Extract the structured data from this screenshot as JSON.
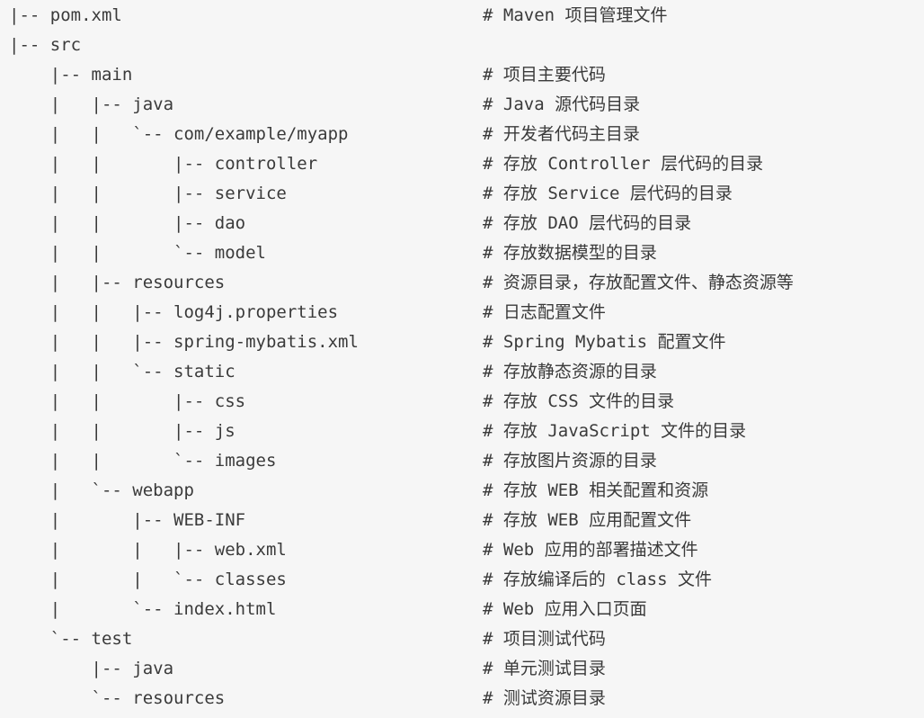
{
  "lines": [
    {
      "tree": "|-- pom.xml",
      "comment": "# Maven 项目管理文件"
    },
    {
      "tree": "|-- src",
      "comment": ""
    },
    {
      "tree": "    |-- main",
      "comment": "# 项目主要代码"
    },
    {
      "tree": "    |   |-- java",
      "comment": "# Java 源代码目录"
    },
    {
      "tree": "    |   |   `-- com/example/myapp",
      "comment": "# 开发者代码主目录"
    },
    {
      "tree": "    |   |       |-- controller",
      "comment": "# 存放 Controller 层代码的目录"
    },
    {
      "tree": "    |   |       |-- service",
      "comment": "# 存放 Service 层代码的目录"
    },
    {
      "tree": "    |   |       |-- dao",
      "comment": "# 存放 DAO 层代码的目录"
    },
    {
      "tree": "    |   |       `-- model",
      "comment": "# 存放数据模型的目录"
    },
    {
      "tree": "    |   |-- resources",
      "comment": "# 资源目录，存放配置文件、静态资源等"
    },
    {
      "tree": "    |   |   |-- log4j.properties",
      "comment": "# 日志配置文件"
    },
    {
      "tree": "    |   |   |-- spring-mybatis.xml",
      "comment": "# Spring Mybatis 配置文件"
    },
    {
      "tree": "    |   |   `-- static",
      "comment": "# 存放静态资源的目录"
    },
    {
      "tree": "    |   |       |-- css",
      "comment": "# 存放 CSS 文件的目录"
    },
    {
      "tree": "    |   |       |-- js",
      "comment": "# 存放 JavaScript 文件的目录"
    },
    {
      "tree": "    |   |       `-- images",
      "comment": "# 存放图片资源的目录"
    },
    {
      "tree": "    |   `-- webapp",
      "comment": "# 存放 WEB 相关配置和资源"
    },
    {
      "tree": "    |       |-- WEB-INF",
      "comment": "# 存放 WEB 应用配置文件"
    },
    {
      "tree": "    |       |   |-- web.xml",
      "comment": "# Web 应用的部署描述文件"
    },
    {
      "tree": "    |       |   `-- classes",
      "comment": "# 存放编译后的 class 文件"
    },
    {
      "tree": "    |       `-- index.html",
      "comment": "# Web 应用入口页面"
    },
    {
      "tree": "    `-- test",
      "comment": "# 项目测试代码"
    },
    {
      "tree": "        |-- java",
      "comment": "# 单元测试目录"
    },
    {
      "tree": "        `-- resources",
      "comment": "# 测试资源目录"
    }
  ]
}
